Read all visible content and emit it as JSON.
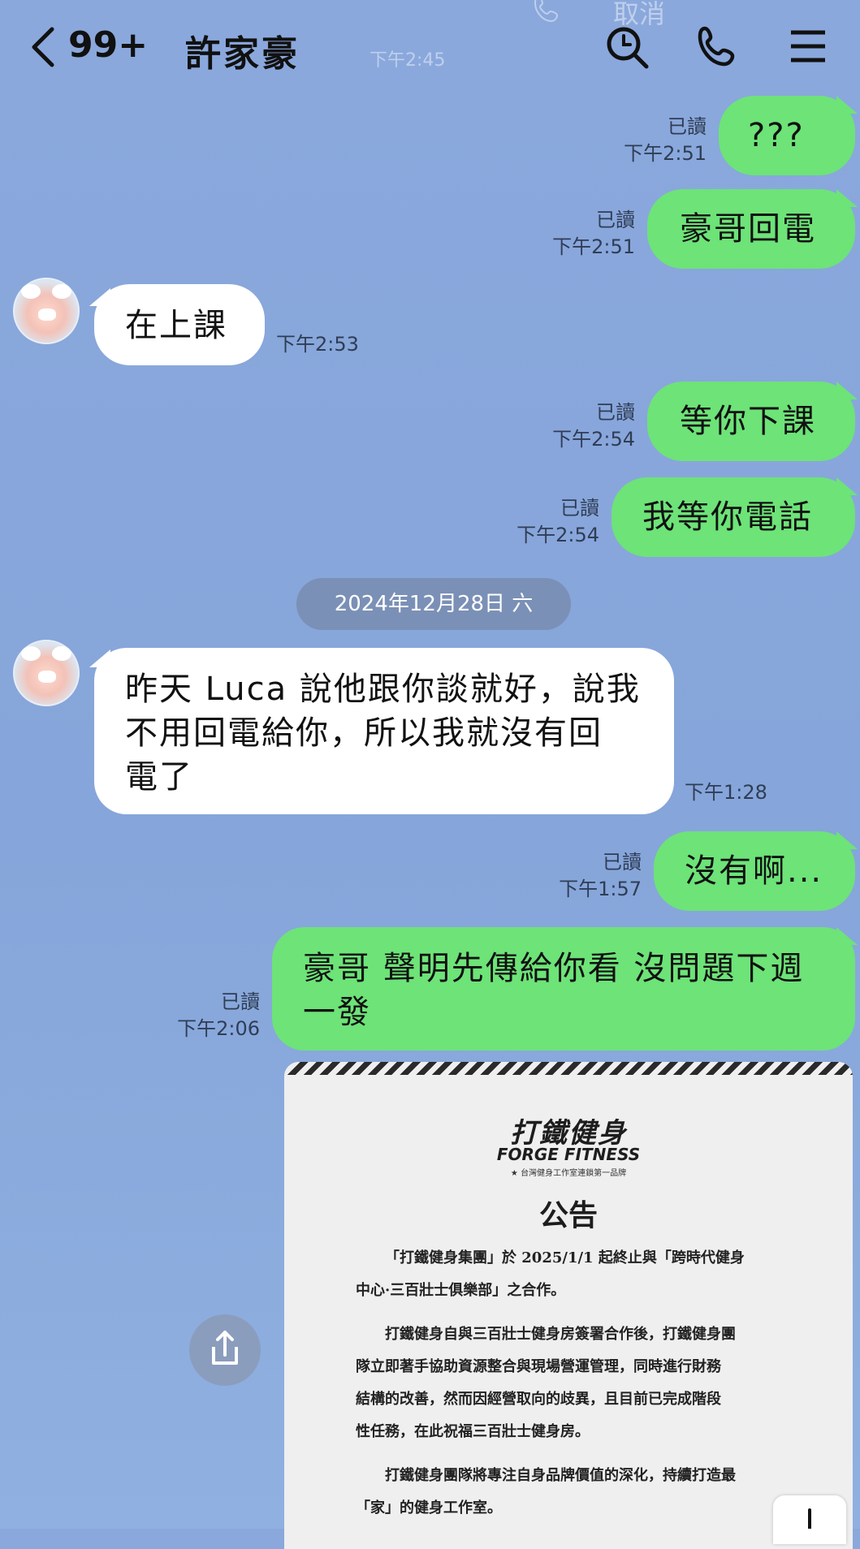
{
  "header": {
    "back_count": "99+",
    "contact_name": "許家豪",
    "overlay_cancel": "取消",
    "overlay_time": "下午2:45"
  },
  "messages": [
    {
      "side": "right",
      "text": "???",
      "read": "已讀",
      "time": "下午2:51"
    },
    {
      "side": "right",
      "text": "豪哥回電",
      "read": "已讀",
      "time": "下午2:51"
    },
    {
      "side": "left",
      "text": "在上課",
      "time": "下午2:53"
    },
    {
      "side": "right",
      "text": "等你下課",
      "read": "已讀",
      "time": "下午2:54"
    },
    {
      "side": "right",
      "text": "我等你電話",
      "read": "已讀",
      "time": "下午2:54"
    },
    {
      "side": "left",
      "lines": [
        "昨天 Luca 說他跟你談就好，說我",
        "不用回電給你，所以我就沒有回",
        "電了"
      ],
      "time": "下午1:28"
    },
    {
      "side": "right",
      "text": "沒有啊...",
      "read": "已讀",
      "time": "下午1:57"
    },
    {
      "side": "right",
      "lines": [
        "豪哥 聲明先傳給你看 沒問題下週",
        "一發"
      ],
      "read": "已讀",
      "time": "下午2:06"
    }
  ],
  "date_separator": "2024年12月28日 六",
  "announcement": {
    "brand_cn": "打鐵健身",
    "brand_en": "FORGE FITNESS",
    "brand_tagline": "★ 台灣健身工作室連鎖第一品牌",
    "title": "公告",
    "paragraphs": [
      [
        "「打鐵健身集團」於 2025/1/1 起終止與「跨時代健身",
        "中心·三百壯士俱樂部」之合作。"
      ],
      [
        "打鐵健身自與三百壯士健身房簽署合作後，打鐵健身團",
        "隊立即著手協助資源整合與現場營運管理，同時進行財務",
        "結構的改善，然而因經營取向的歧異，且目前已完成階段",
        "性任務，在此祝福三百壯士健身房。"
      ],
      [
        "打鐵健身團隊將專注自身品牌價值的深化，持續打造最",
        "「家」的健身工作室。"
      ]
    ]
  },
  "colors": {
    "green_bubble": "#6de378",
    "white_bubble": "#ffffff",
    "background": "#8aa8dc",
    "date_pill": "#7b90b6"
  },
  "icons": [
    "back-chevron-icon",
    "search-icon",
    "phone-icon",
    "menu-icon",
    "share-icon",
    "scroll-down-icon"
  ]
}
